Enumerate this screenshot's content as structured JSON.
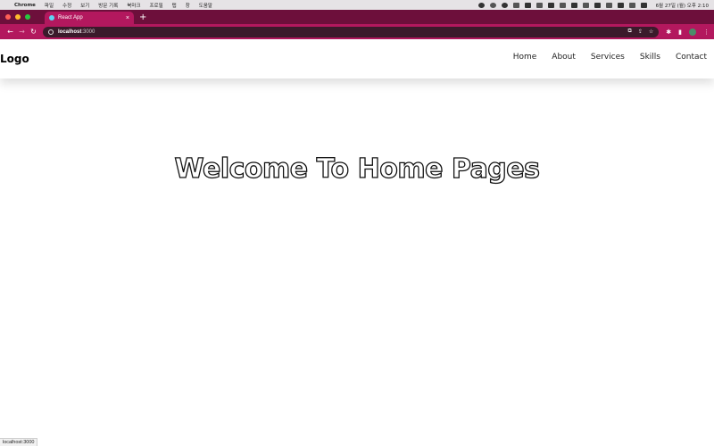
{
  "menubar": {
    "app_name": "Chrome",
    "items": [
      "파일",
      "수정",
      "보기",
      "방문 기록",
      "북마크",
      "프로필",
      "탭",
      "창",
      "도움말"
    ],
    "clock": "6월 27일 (월) 오후 2:10"
  },
  "browser": {
    "tab_title": "React App",
    "tab_close": "×",
    "new_tab": "+",
    "url_host": "localhost",
    "url_port": ":3000",
    "status_link": "localhost:3000"
  },
  "site": {
    "logo": "Logo",
    "nav": [
      "Home",
      "About",
      "Services",
      "Skills",
      "Contact"
    ],
    "hero_title": "Welcome To Home Pages"
  },
  "colors": {
    "tabbar": "#6d0f3b",
    "toolbar": "#b3185e"
  }
}
